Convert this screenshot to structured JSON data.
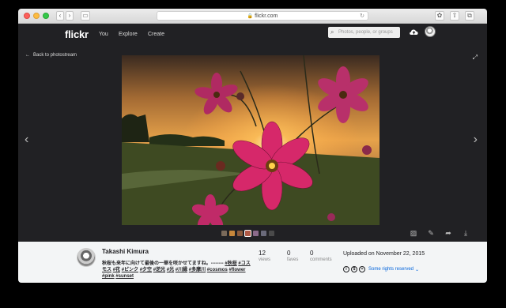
{
  "browser": {
    "url": "flickr.com",
    "lock_icon": "lock-icon",
    "reload_icon": "reload-icon"
  },
  "nav": {
    "logo": "flickr",
    "links": [
      "You",
      "Explore",
      "Create"
    ],
    "search_placeholder": "Photos, people, or groups"
  },
  "stage": {
    "back_label": "Back to photostream",
    "prev_icon": "‹",
    "next_icon": "›"
  },
  "photo": {
    "owner": "Takashi Kimura",
    "description_text": "秋桜も来年に向けて最後の一華を咲かせてますね。-------- ",
    "tags": [
      "#秋桜",
      "#コスモス",
      "#花",
      "#ピンク",
      "#夕空",
      "#逆光",
      "#光",
      "#川縁",
      "#多摩川",
      "#cosmos",
      "#flower",
      "#pink",
      "#sunset"
    ],
    "stats": [
      {
        "value": "12",
        "label": "views"
      },
      {
        "value": "0",
        "label": "faves"
      },
      {
        "value": "0",
        "label": "comments"
      }
    ],
    "uploaded": "Uploaded on November 22, 2015",
    "rights": "Some rights reserved",
    "cc_badges": [
      "i",
      "$",
      "="
    ]
  },
  "thumbnails": {
    "colors": [
      "#7a6a5a",
      "#c7873b",
      "#8a5a3c",
      "#b05a46",
      "#8a6a8a",
      "#6a6a7a",
      "#4a4a4a"
    ]
  },
  "colors": {
    "background": "#212124",
    "info_bg": "#f3f5f6",
    "link_blue": "#0063dc"
  }
}
